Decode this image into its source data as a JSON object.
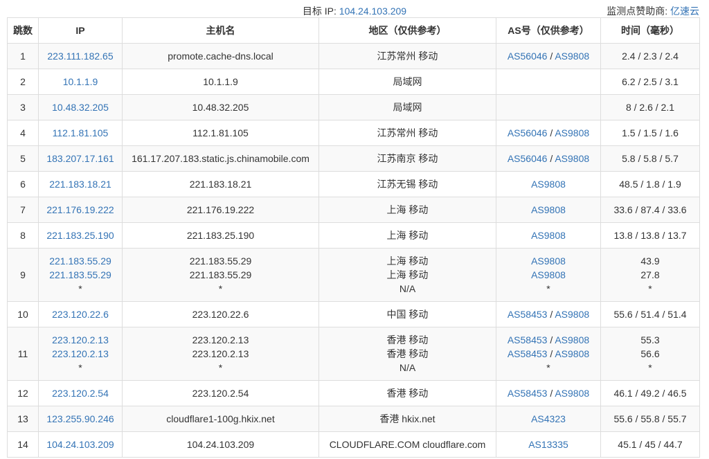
{
  "header": {
    "target_label": "目标 IP:",
    "target_ip": "104.24.103.209",
    "sponsor_label": "监测点赞助商:",
    "sponsor_name": "亿速云"
  },
  "columns": [
    "跳数",
    "IP",
    "主机名",
    "地区（仅供参考）",
    "AS号（仅供参考）",
    "时间（毫秒）"
  ],
  "hops": [
    {
      "hop": "1",
      "lines": [
        {
          "ip": "223.111.182.65",
          "host": "promote.cache-dns.local",
          "region": "江苏常州 移动",
          "as": [
            "AS56046",
            "AS9808"
          ],
          "time": "2.4 / 2.3 / 2.4"
        }
      ]
    },
    {
      "hop": "2",
      "lines": [
        {
          "ip": "10.1.1.9",
          "host": "10.1.1.9",
          "region": "局域网",
          "as": [],
          "time": "6.2 / 2.5 / 3.1"
        }
      ]
    },
    {
      "hop": "3",
      "lines": [
        {
          "ip": "10.48.32.205",
          "host": "10.48.32.205",
          "region": "局域网",
          "as": [],
          "time": "8 / 2.6 / 2.1"
        }
      ]
    },
    {
      "hop": "4",
      "lines": [
        {
          "ip": "112.1.81.105",
          "host": "112.1.81.105",
          "region": "江苏常州 移动",
          "as": [
            "AS56046",
            "AS9808"
          ],
          "time": "1.5 / 1.5 / 1.6"
        }
      ]
    },
    {
      "hop": "5",
      "lines": [
        {
          "ip": "183.207.17.161",
          "host": "161.17.207.183.static.js.chinamobile.com",
          "region": "江苏南京 移动",
          "as": [
            "AS56046",
            "AS9808"
          ],
          "time": "5.8 / 5.8 / 5.7"
        }
      ]
    },
    {
      "hop": "6",
      "lines": [
        {
          "ip": "221.183.18.21",
          "host": "221.183.18.21",
          "region": "江苏无锡 移动",
          "as": [
            "AS9808"
          ],
          "time": "48.5 / 1.8 / 1.9"
        }
      ]
    },
    {
      "hop": "7",
      "lines": [
        {
          "ip": "221.176.19.222",
          "host": "221.176.19.222",
          "region": "上海 移动",
          "as": [
            "AS9808"
          ],
          "time": "33.6 / 87.4 / 33.6"
        }
      ]
    },
    {
      "hop": "8",
      "lines": [
        {
          "ip": "221.183.25.190",
          "host": "221.183.25.190",
          "region": "上海 移动",
          "as": [
            "AS9808"
          ],
          "time": "13.8 / 13.8 / 13.7"
        }
      ]
    },
    {
      "hop": "9",
      "lines": [
        {
          "ip": "221.183.55.29",
          "host": "221.183.55.29",
          "region": "上海 移动",
          "as": [
            "AS9808"
          ],
          "time": "43.9"
        },
        {
          "ip": "221.183.55.29",
          "host": "221.183.55.29",
          "region": "上海 移动",
          "as": [
            "AS9808"
          ],
          "time": "27.8"
        },
        {
          "ip": "*",
          "host": "*",
          "region": "N/A",
          "as": [
            "*"
          ],
          "time": "*"
        }
      ]
    },
    {
      "hop": "10",
      "lines": [
        {
          "ip": "223.120.22.6",
          "host": "223.120.22.6",
          "region": "中国 移动",
          "as": [
            "AS58453",
            "AS9808"
          ],
          "time": "55.6 / 51.4 / 51.4"
        }
      ]
    },
    {
      "hop": "11",
      "lines": [
        {
          "ip": "223.120.2.13",
          "host": "223.120.2.13",
          "region": "香港 移动",
          "as": [
            "AS58453",
            "AS9808"
          ],
          "time": "55.3"
        },
        {
          "ip": "223.120.2.13",
          "host": "223.120.2.13",
          "region": "香港 移动",
          "as": [
            "AS58453",
            "AS9808"
          ],
          "time": "56.6"
        },
        {
          "ip": "*",
          "host": "*",
          "region": "N/A",
          "as": [
            "*"
          ],
          "time": "*"
        }
      ]
    },
    {
      "hop": "12",
      "lines": [
        {
          "ip": "223.120.2.54",
          "host": "223.120.2.54",
          "region": "香港 移动",
          "as": [
            "AS58453",
            "AS9808"
          ],
          "time": "46.1 / 49.2 / 46.5"
        }
      ]
    },
    {
      "hop": "13",
      "lines": [
        {
          "ip": "123.255.90.246",
          "host": "cloudflare1-100g.hkix.net",
          "region": "香港 hkix.net",
          "as": [
            "AS4323"
          ],
          "time": "55.6 / 55.8 / 55.7"
        }
      ]
    },
    {
      "hop": "14",
      "lines": [
        {
          "ip": "104.24.103.209",
          "host": "104.24.103.209",
          "region": "CLOUDFLARE.COM cloudflare.com",
          "as": [
            "AS13335"
          ],
          "time": "45.1 / 45 / 44.7"
        }
      ]
    }
  ]
}
